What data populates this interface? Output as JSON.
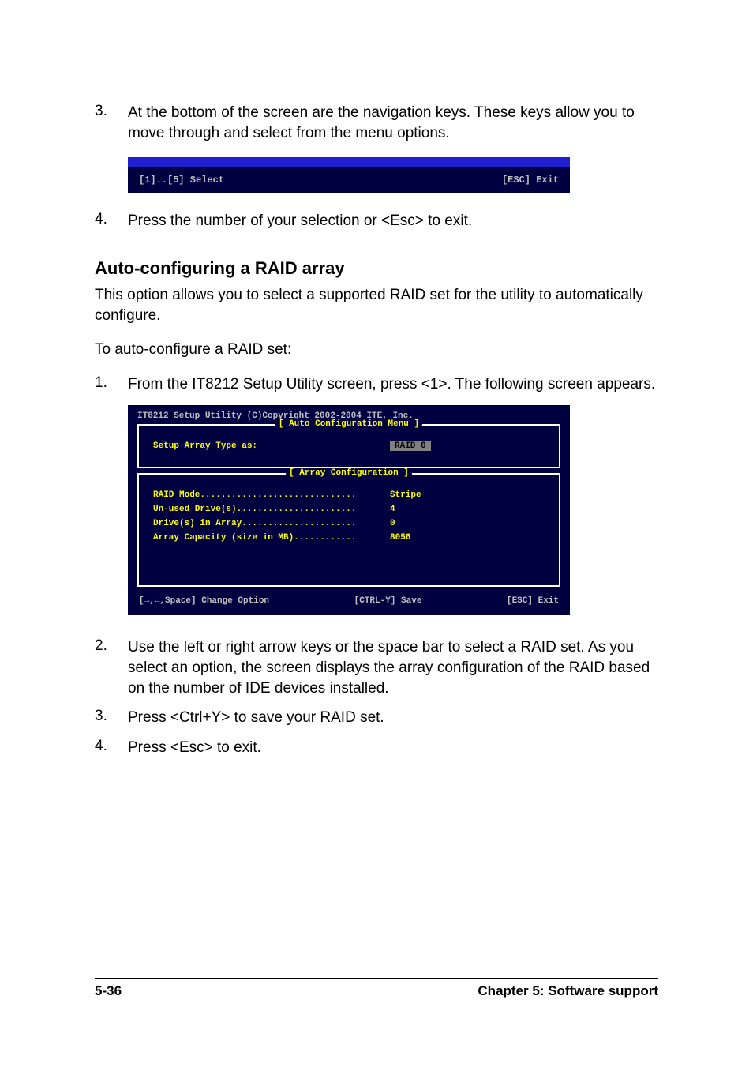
{
  "steps_a": [
    {
      "num": "3.",
      "text": "At the bottom of the screen are the navigation keys. These keys allow you to move through and select from the menu options."
    },
    {
      "num": "4.",
      "text": "Press the number of your selection or <Esc> to exit."
    }
  ],
  "navbar": {
    "left": "[1]..[5] Select",
    "right": "[ESC] Exit"
  },
  "section_title": "Auto-configuring a RAID array",
  "section_intro": "This option allows you to select a supported RAID set for the utility to automatically configure.",
  "section_lead": "To auto-configure a RAID set:",
  "steps_b": [
    {
      "num": "1.",
      "text": "From the IT8212 Setup Utility screen, press <1>. The following screen appears."
    },
    {
      "num": "2.",
      "text": "Use the left or right arrow keys or the space bar to select a RAID set. As you select an option, the screen displays the array configuration of the RAID based on the number of IDE devices installed."
    },
    {
      "num": "3.",
      "text": "Press <Ctrl+Y> to save your RAID set."
    },
    {
      "num": "4.",
      "text": "Press <Esc> to exit."
    }
  ],
  "bios": {
    "title": "IT8212 Setup Utility (C)Copyright 2002-2004 ITE, Inc.",
    "box1_legend": "[ Auto Configuration Menu ]",
    "box1_label": "Setup Array Type as:",
    "box1_value": "RAID 0",
    "box2_legend": "[ Array Configuration ]",
    "rows": [
      {
        "label": "RAID Mode..............................",
        "value": "Stripe"
      },
      {
        "label": "Un-used Drive(s).......................",
        "value": "4"
      },
      {
        "label": "Drive(s) in Array......................",
        "value": "0"
      },
      {
        "label": "Array Capacity (size in MB)............",
        "value": "8056"
      }
    ],
    "footer_left": "[→,←,Space] Change Option",
    "footer_mid": "[CTRL-Y] Save",
    "footer_right": "[ESC] Exit"
  },
  "page_footer": {
    "left": "5-36",
    "right": "Chapter 5: Software support"
  }
}
